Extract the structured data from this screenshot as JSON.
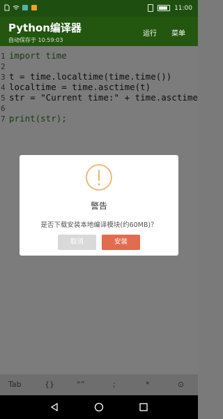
{
  "status_bar": {
    "time": "11:00"
  },
  "app_bar": {
    "title": "Python编译器",
    "subtitle": "自动保存于 10:59:03",
    "run_label": "运行",
    "menu_label": "菜单"
  },
  "editor": {
    "lines": [
      {
        "num": "1",
        "text": "import time"
      },
      {
        "num": "2",
        "text": ""
      },
      {
        "num": "3",
        "text": "t = time.localtime(time.time())"
      },
      {
        "num": "4",
        "text": "localtime = time.asctime(t)"
      },
      {
        "num": "5",
        "text": "str = \"Current time:\" + time.asctime(t)"
      },
      {
        "num": "6",
        "text": ""
      },
      {
        "num": "7",
        "text": "print(str);"
      }
    ]
  },
  "dialog": {
    "title": "警告",
    "message": "是否下载安装本地编译模块(约60MB)？",
    "cancel_label": "取消",
    "install_label": "安装"
  },
  "keybar": {
    "keys": [
      "Tab",
      "{}",
      "“”",
      ";",
      "*",
      "⊙"
    ]
  },
  "colors": {
    "appbar": "#23560f",
    "accent_button": "#e36b4e",
    "warning_icon": "#f0b97a"
  }
}
